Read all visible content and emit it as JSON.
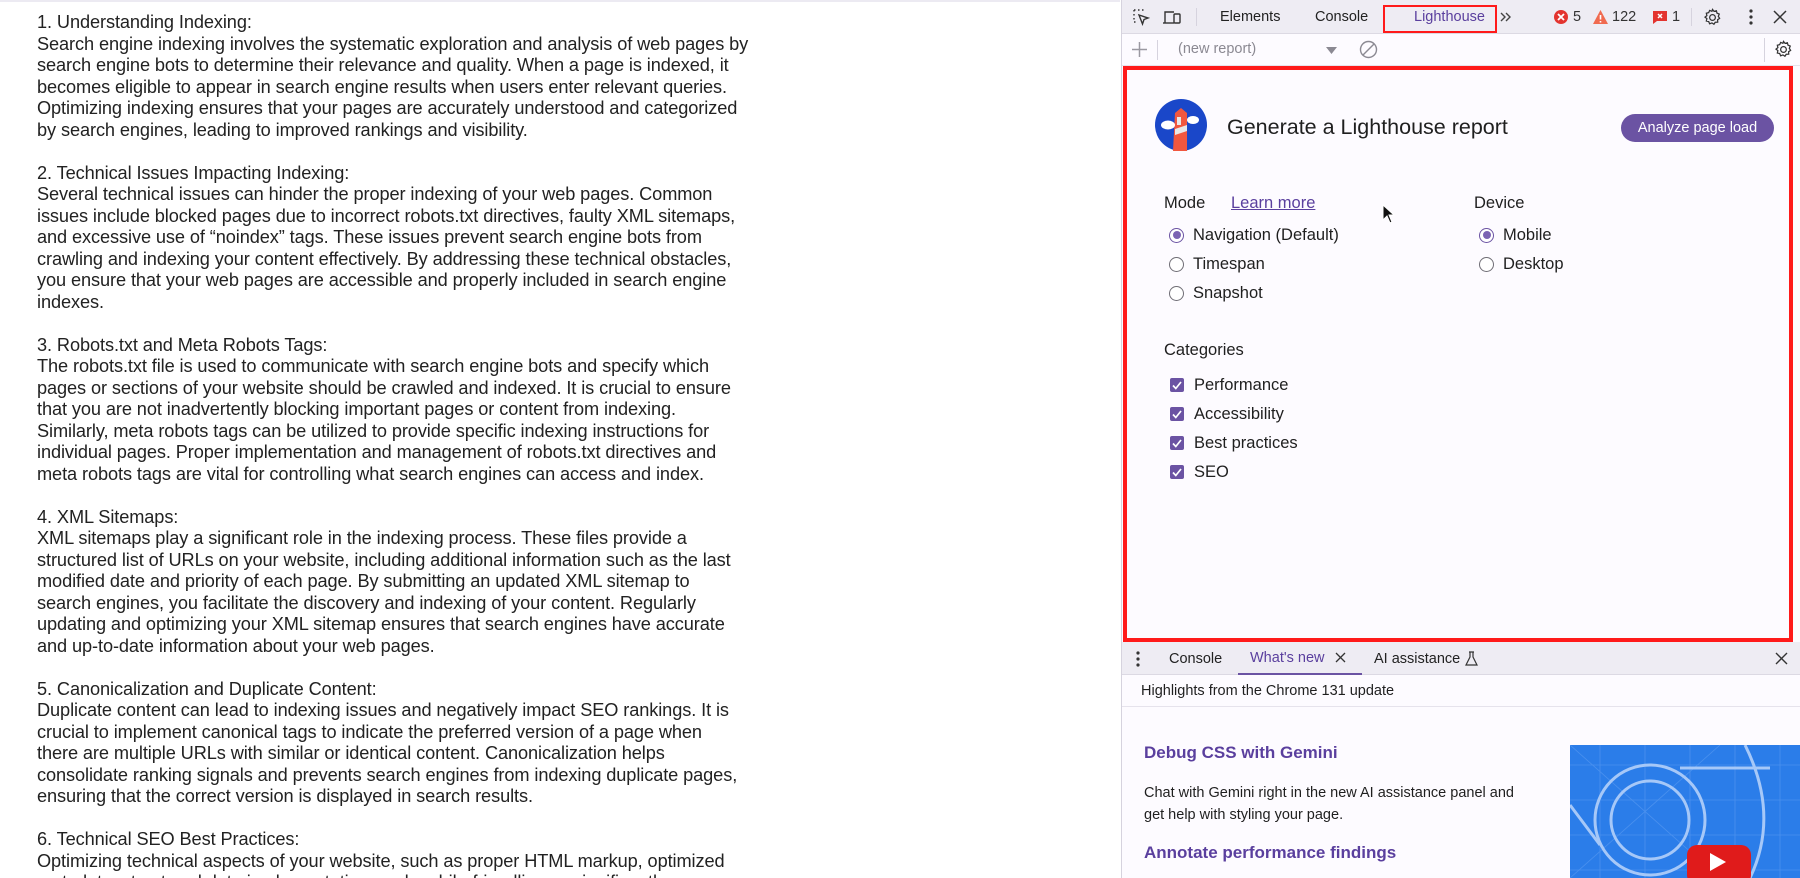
{
  "article": {
    "sections": [
      {
        "heading": "1. Understanding Indexing:",
        "body": "Search engine indexing involves the systematic exploration and analysis of web pages by\nsearch engine bots to determine their relevance and quality. When a page is indexed, it\nbecomes eligible to appear in search engine results when users enter relevant queries.\nOptimizing indexing ensures that your pages are accurately understood and categorized\nby search engines, leading to improved rankings and visibility."
      },
      {
        "heading": "2. Technical Issues Impacting Indexing:",
        "body": "Several technical issues can hinder the proper indexing of your web pages. Common\nissues include blocked pages due to incorrect robots.txt directives, faulty XML sitemaps,\nand excessive use of “noindex” tags. These issues prevent search engine bots from\ncrawling and indexing your content effectively. By addressing these technical obstacles,\nyou ensure that your web pages are accessible and properly included in search engine\nindexes."
      },
      {
        "heading": "3. Robots.txt and Meta Robots Tags:",
        "body": "The robots.txt file is used to communicate with search engine bots and specify which\npages or sections of your website should be crawled and indexed. It is crucial to ensure\nthat you are not inadvertently blocking important pages or content from indexing.\nSimilarly, meta robots tags can be utilized to provide specific indexing instructions for\nindividual pages. Proper implementation and management of robots.txt directives and\nmeta robots tags are vital for controlling what search engines can access and index."
      },
      {
        "heading": "4. XML Sitemaps:",
        "body": "XML sitemaps play a significant role in the indexing process. These files provide a\nstructured list of URLs on your website, including additional information such as the last\nmodified date and priority of each page. By submitting an updated XML sitemap to\nsearch engines, you facilitate the discovery and indexing of your content. Regularly\nupdating and optimizing your XML sitemap ensures that search engines have accurate\nand up-to-date information about your web pages."
      },
      {
        "heading": "5. Canonicalization and Duplicate Content:",
        "body": "Duplicate content can lead to indexing issues and negatively impact SEO rankings. It is\ncrucial to implement canonical tags to indicate the preferred version of a page when\nthere are multiple URLs with similar or identical content. Canonicalization helps\nconsolidate ranking signals and prevents search engines from indexing duplicate pages,\nensuring that the correct version is displayed in search results."
      },
      {
        "heading": "6. Technical SEO Best Practices:",
        "body": "Optimizing technical aspects of your website, such as proper HTML markup, optimized\nmetadata, structured data implementation, and mobile-friendliness, significantly"
      }
    ]
  },
  "devtools": {
    "tabs": [
      {
        "label": "Elements"
      },
      {
        "label": "Console"
      },
      {
        "label": "Lighthouse",
        "active": true
      }
    ],
    "more_tabs_label": "»",
    "counts": {
      "errors": "5",
      "warnings": "122",
      "issues": "1"
    },
    "subbar": {
      "report_select": "(new report)"
    },
    "lighthouse": {
      "title": "Generate a Lighthouse report",
      "analyze_button": "Analyze page load",
      "mode_label": "Mode",
      "learn_more": "Learn more",
      "modes": [
        {
          "label": "Navigation (Default)",
          "selected": true
        },
        {
          "label": "Timespan",
          "selected": false
        },
        {
          "label": "Snapshot",
          "selected": false
        }
      ],
      "device_label": "Device",
      "devices": [
        {
          "label": "Mobile",
          "selected": true
        },
        {
          "label": "Desktop",
          "selected": false
        }
      ],
      "categories_label": "Categories",
      "categories": [
        {
          "label": "Performance",
          "checked": true
        },
        {
          "label": "Accessibility",
          "checked": true
        },
        {
          "label": "Best practices",
          "checked": true
        },
        {
          "label": "SEO",
          "checked": true
        }
      ]
    },
    "drawer": {
      "tabs": [
        {
          "label": "Console"
        },
        {
          "label": "What's new",
          "active": true
        },
        {
          "label": "AI assistance"
        }
      ],
      "highlights": "Highlights from the Chrome 131 update",
      "whats_new": [
        {
          "heading": "Debug CSS with Gemini",
          "body": "Chat with Gemini right in the new AI assistance panel and get help with styling your page."
        },
        {
          "heading": "Annotate performance findings"
        }
      ]
    },
    "colors": {
      "accent": "#6b53a3",
      "highlight_box": "#ff1a1a",
      "error": "#e3342f",
      "warning": "#f06a4f"
    }
  }
}
